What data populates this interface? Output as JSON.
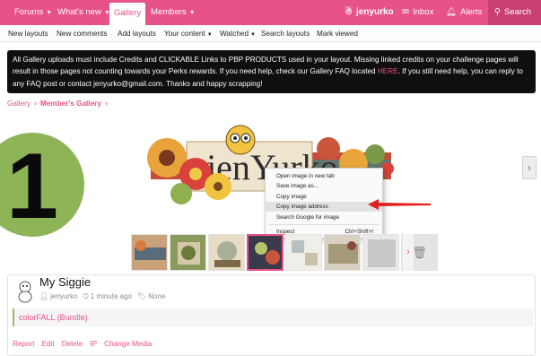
{
  "nav": {
    "forums": "Forums",
    "whats_new": "What's new",
    "gallery": "Gallery",
    "members": "Members",
    "user": "jenyurko",
    "inbox": "Inbox",
    "alerts": "Alerts",
    "search": "Search",
    "accent": "#e8528a"
  },
  "subnav": [
    "New layouts",
    "New comments",
    "Add layouts",
    "Your content",
    "Watched",
    "Search layouts",
    "Mark viewed"
  ],
  "notice": {
    "text_before": "All Gallery uploads must include Credits and CLICKABLE Links to PBP PRODUCTS used in your layout. Missing linked credits on your challenge pages will result in those pages not counting towards your Perks rewards. If you need help, check our Gallery FAQ located ",
    "link": "HERE",
    "text_after": ". If you still need help, you can reply to any FAQ post or contact jenyurko@gmail.com. Thanks and happy scrapping!"
  },
  "breadcrumb": {
    "root": "Gallery",
    "current": "Member's Gallery"
  },
  "step_number": "1",
  "context_menu": {
    "items": [
      "Open image in new tab",
      "Save image as...",
      "Copy image",
      "Copy image address",
      "Search Google for image"
    ],
    "inspect": "Inspect",
    "inspect_shortcut": "Ctrl+Shift+I",
    "highlighted": "Copy image address"
  },
  "media": {
    "title": "My Siggie",
    "author": "jenyurko",
    "time": "1 minute ago",
    "tags": "None",
    "description": "colorFALL (Bundle)"
  },
  "actions": [
    "Report",
    "Edit",
    "Delete",
    "IP",
    "Change Media"
  ]
}
